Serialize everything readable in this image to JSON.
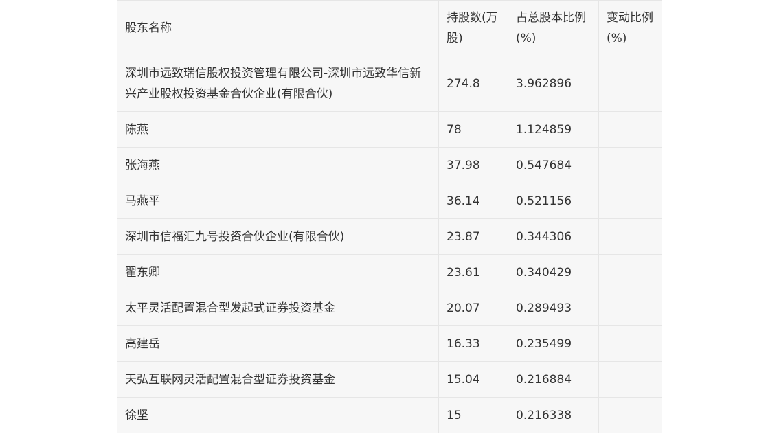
{
  "table": {
    "headers": [
      "股东名称",
      "持股数(万股)",
      "占总股本比例(%)",
      "变动比例(%)"
    ],
    "rows": [
      {
        "name": "深圳市远致瑞信股权投资管理有限公司-深圳市远致华信新兴产业股权投资基金合伙企业(有限合伙)",
        "shares": "274.8",
        "ratio": "3.962896",
        "change": ""
      },
      {
        "name": "陈燕",
        "shares": "78",
        "ratio": "1.124859",
        "change": ""
      },
      {
        "name": "张海燕",
        "shares": "37.98",
        "ratio": "0.547684",
        "change": ""
      },
      {
        "name": "马燕平",
        "shares": "36.14",
        "ratio": "0.521156",
        "change": ""
      },
      {
        "name": "深圳市信福汇九号投资合伙企业(有限合伙)",
        "shares": "23.87",
        "ratio": "0.344306",
        "change": ""
      },
      {
        "name": "翟东卿",
        "shares": "23.61",
        "ratio": "0.340429",
        "change": ""
      },
      {
        "name": "太平灵活配置混合型发起式证券投资基金",
        "shares": "20.07",
        "ratio": "0.289493",
        "change": ""
      },
      {
        "name": "高建岳",
        "shares": "16.33",
        "ratio": "0.235499",
        "change": ""
      },
      {
        "name": "天弘互联网灵活配置混合型证券投资基金",
        "shares": "15.04",
        "ratio": "0.216884",
        "change": ""
      },
      {
        "name": "徐坚",
        "shares": "15",
        "ratio": "0.216338",
        "change": ""
      }
    ]
  }
}
